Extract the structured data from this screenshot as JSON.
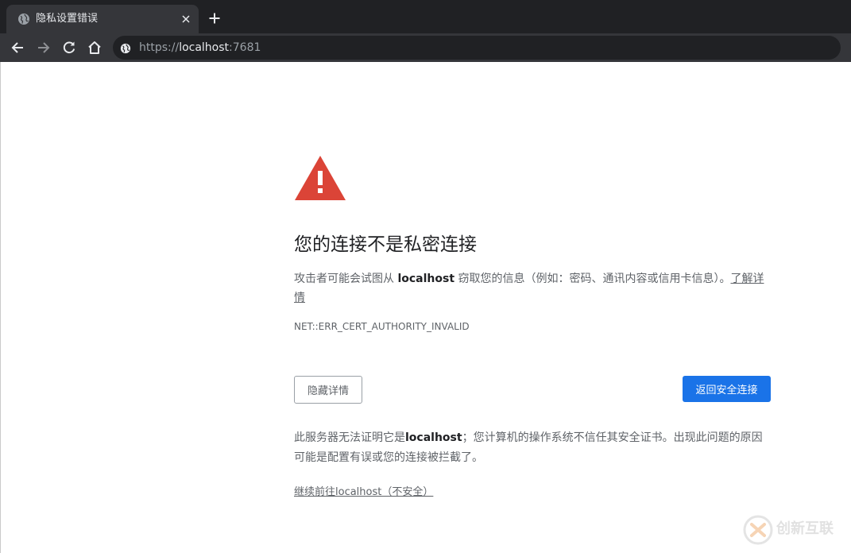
{
  "browser": {
    "tab_title": "隐私设置错误",
    "url_scheme": "https://",
    "url_host": "localhost",
    "url_port": ":7681"
  },
  "page": {
    "heading": "您的连接不是私密连接",
    "desc_pre": "攻击者可能会试图从 ",
    "desc_host": "localhost",
    "desc_post": " 窃取您的信息（例如：密码、通讯内容或信用卡信息）。",
    "learn_more": "了解详情",
    "error_code": "NET::ERR_CERT_AUTHORITY_INVALID",
    "hide_details_button": "隐藏详情",
    "back_to_safety_button": "返回安全连接",
    "details_pre": "此服务器无法证明它是",
    "details_host": "localhost",
    "details_post": "；您计算机的操作系统不信任其安全证书。出现此问题的原因可能是配置有误或您的连接被拦截了。",
    "proceed_link": "继续前往localhost（不安全）"
  },
  "watermark": {
    "text": "创新互联"
  },
  "colors": {
    "warning_red": "#db4437",
    "primary_blue": "#1a73e8",
    "tab_strip": "#202124",
    "toolbar": "#35363a"
  }
}
